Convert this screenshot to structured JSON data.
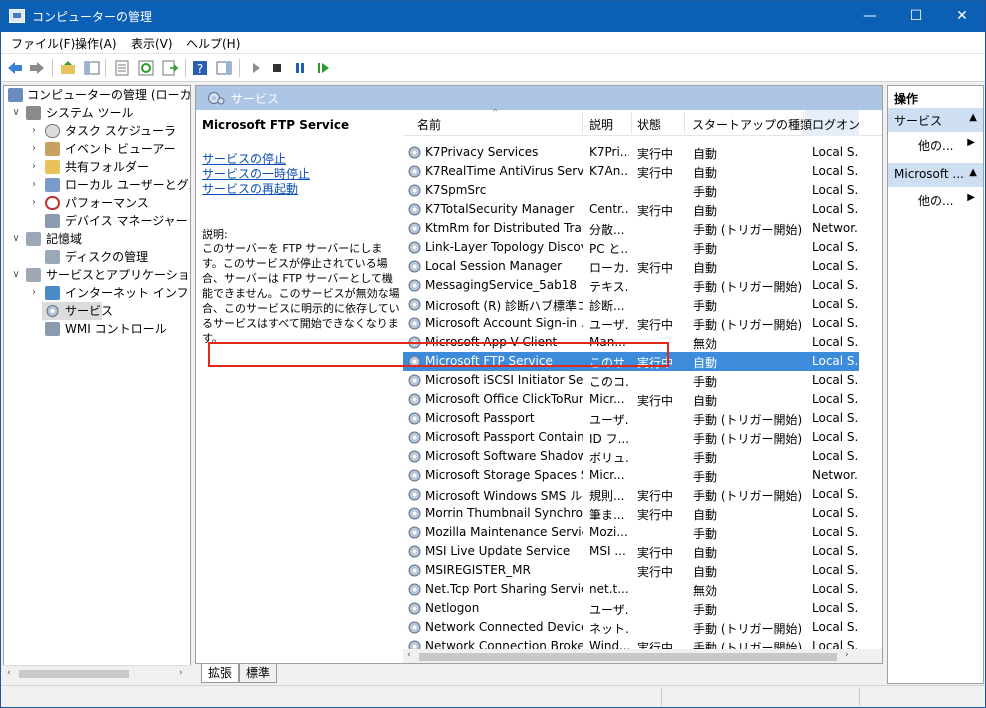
{
  "window": {
    "title": "コンピューターの管理",
    "minimize": "—",
    "maximize": "☐",
    "close": "✕"
  },
  "menu": [
    "ファイル(F)",
    "操作(A)",
    "表示(V)",
    "ヘルプ(H)"
  ],
  "tree": {
    "root": "コンピューターの管理 (ローカル)",
    "system_tools": "システム ツール",
    "task_scheduler": "タスク スケジューラ",
    "event_viewer": "イベント ビューアー",
    "shared_folders": "共有フォルダー",
    "local_users": "ローカル ユーザーとグループ",
    "performance": "パフォーマンス",
    "device_manager": "デバイス マネージャー",
    "storage": "記憶域",
    "disk_management": "ディスクの管理",
    "services_apps": "サービスとアプリケーション",
    "iis": "インターネット インフォメーシ",
    "services": "サービス",
    "wmi": "WMI コントロール"
  },
  "center": {
    "header": "サービス",
    "desc_title": "Microsoft FTP Service",
    "links": [
      "サービスの停止",
      "サービスの一時停止",
      "サービスの再起動"
    ],
    "desc_label": "説明:",
    "desc_body": "このサーバーを FTP サーバーにします。このサービスが停止されている場合、サーバーは FTP サーバーとして機能できません。このサービスが無効な場合、このサービスに明示的に依存しているサービスはすべて開始できなくなります。"
  },
  "columns": {
    "name": "名前",
    "desc": "説明",
    "status": "状態",
    "startup": "スタートアップの種類",
    "logon": "ログオン"
  },
  "services": [
    {
      "name": "K7Privacy Services",
      "desc": "K7Pri...",
      "status": "実行中",
      "startup": "自動",
      "logon": "Local S..."
    },
    {
      "name": "K7RealTime AntiVirus Services",
      "desc": "K7An...",
      "status": "実行中",
      "startup": "自動",
      "logon": "Local S..."
    },
    {
      "name": "K7SpmSrc",
      "desc": "",
      "status": "",
      "startup": "手動",
      "logon": "Local S..."
    },
    {
      "name": "K7TotalSecurity Manager",
      "desc": "Centr...",
      "status": "実行中",
      "startup": "自動",
      "logon": "Local S..."
    },
    {
      "name": "KtmRm for Distributed Trans...",
      "desc": "分散...",
      "status": "",
      "startup": "手動 (トリガー開始)",
      "logon": "Networ..."
    },
    {
      "name": "Link-Layer Topology Discov...",
      "desc": "PC と...",
      "status": "",
      "startup": "手動",
      "logon": "Local S..."
    },
    {
      "name": "Local Session Manager",
      "desc": "ローカ...",
      "status": "実行中",
      "startup": "自動",
      "logon": "Local S..."
    },
    {
      "name": "MessagingService_5ab18",
      "desc": "テキス...",
      "status": "",
      "startup": "手動 (トリガー開始)",
      "logon": "Local S..."
    },
    {
      "name": "Microsoft (R) 診断ハブ標準コ...",
      "desc": "診断...",
      "status": "",
      "startup": "手動",
      "logon": "Local S..."
    },
    {
      "name": "Microsoft Account Sign-in ...",
      "desc": "ユーザ...",
      "status": "実行中",
      "startup": "手動 (トリガー開始)",
      "logon": "Local S..."
    },
    {
      "name": "Microsoft App-V Client",
      "desc": "Man...",
      "status": "",
      "startup": "無効",
      "logon": "Local S..."
    },
    {
      "name": "Microsoft FTP Service",
      "desc": "このサ...",
      "status": "実行中",
      "startup": "自動",
      "logon": "Local S..."
    },
    {
      "name": "Microsoft iSCSI Initiator Ser...",
      "desc": "このコ...",
      "status": "",
      "startup": "手動",
      "logon": "Local S..."
    },
    {
      "name": "Microsoft Office ClickToRun...",
      "desc": "Micr...",
      "status": "実行中",
      "startup": "自動",
      "logon": "Local S..."
    },
    {
      "name": "Microsoft Passport",
      "desc": "ユーザ...",
      "status": "",
      "startup": "手動 (トリガー開始)",
      "logon": "Local S..."
    },
    {
      "name": "Microsoft Passport Container",
      "desc": "ID フ...",
      "status": "",
      "startup": "手動 (トリガー開始)",
      "logon": "Local S..."
    },
    {
      "name": "Microsoft Software Shadow...",
      "desc": "ボリュ...",
      "status": "",
      "startup": "手動",
      "logon": "Local S..."
    },
    {
      "name": "Microsoft Storage Spaces S...",
      "desc": "Micr...",
      "status": "",
      "startup": "手動",
      "logon": "Networ..."
    },
    {
      "name": "Microsoft Windows SMS ル...",
      "desc": "規則...",
      "status": "実行中",
      "startup": "手動 (トリガー開始)",
      "logon": "Local S..."
    },
    {
      "name": "Morrin Thumbnail Synchro...",
      "desc": "筆ま...",
      "status": "実行中",
      "startup": "自動",
      "logon": "Local S..."
    },
    {
      "name": "Mozilla Maintenance Service",
      "desc": "Mozi...",
      "status": "",
      "startup": "手動",
      "logon": "Local S..."
    },
    {
      "name": "MSI Live Update Service",
      "desc": "MSI ...",
      "status": "実行中",
      "startup": "自動",
      "logon": "Local S..."
    },
    {
      "name": "MSIREGISTER_MR",
      "desc": "",
      "status": "実行中",
      "startup": "自動",
      "logon": "Local S..."
    },
    {
      "name": "Net.Tcp Port Sharing Service",
      "desc": "net.t...",
      "status": "",
      "startup": "無効",
      "logon": "Local S..."
    },
    {
      "name": "Netlogon",
      "desc": "ユーザ...",
      "status": "",
      "startup": "手動",
      "logon": "Local S..."
    },
    {
      "name": "Network Connected Device...",
      "desc": "ネット...",
      "status": "",
      "startup": "手動 (トリガー開始)",
      "logon": "Local S..."
    },
    {
      "name": "Network Connection Broker",
      "desc": "Wind...",
      "status": "実行中",
      "startup": "手動 (トリガー開始)",
      "logon": "Local S..."
    }
  ],
  "tabs": [
    "拡張",
    "標準"
  ],
  "actions": {
    "header": "操作",
    "group1": "サービス",
    "more1": "他の...",
    "group2": "Microsoft ...",
    "more2": "他の..."
  },
  "colors": {
    "titlebar": "#0b5fb5",
    "selection": "#3c8cdb",
    "highlight_box": "#e0281c",
    "panel_header": "#adc6e5"
  }
}
